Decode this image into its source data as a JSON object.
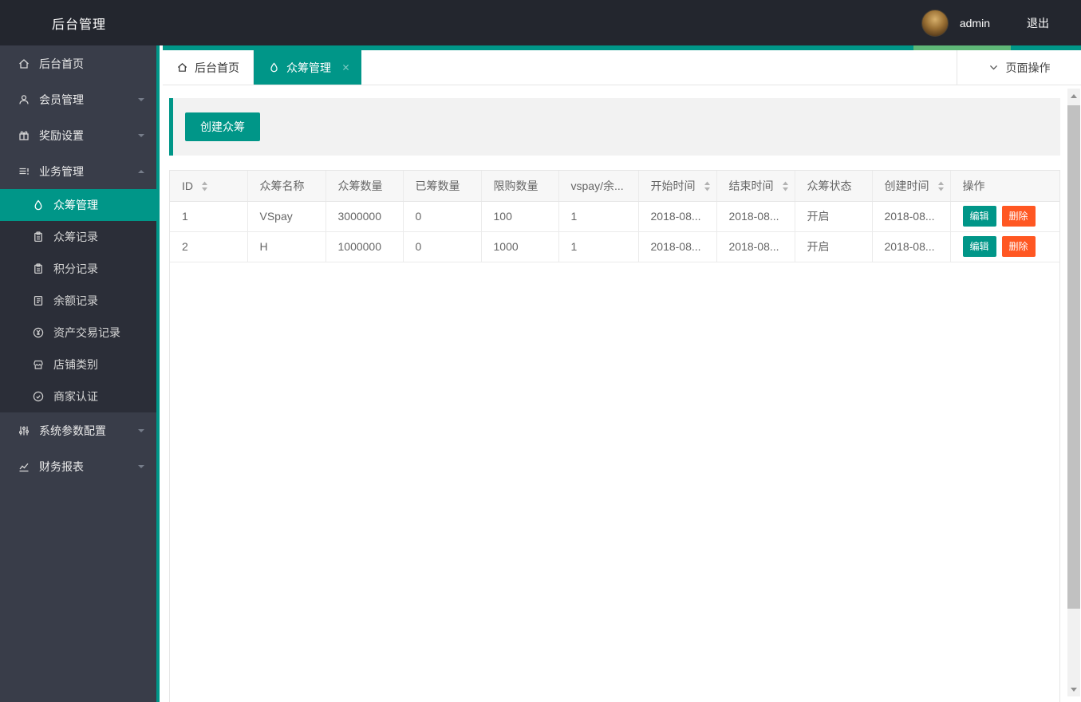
{
  "header": {
    "title": "后台管理",
    "username": "admin",
    "logout_label": "退出"
  },
  "tabs": [
    {
      "label": "后台首页",
      "icon": "home",
      "active": false
    },
    {
      "label": "众筹管理",
      "icon": "water-drop",
      "active": true,
      "closable": true
    }
  ],
  "page_ops": {
    "label": "页面操作"
  },
  "sidebar": {
    "items": [
      {
        "label": "后台首页",
        "icon": "home",
        "expandable": false
      },
      {
        "label": "会员管理",
        "icon": "user",
        "expandable": true,
        "expanded": false
      },
      {
        "label": "奖励设置",
        "icon": "gift",
        "expandable": true,
        "expanded": false
      },
      {
        "label": "业务管理",
        "icon": "list",
        "expandable": true,
        "expanded": true,
        "children": [
          {
            "label": "众筹管理",
            "icon": "water-drop",
            "active": true
          },
          {
            "label": "众筹记录",
            "icon": "clipboard"
          },
          {
            "label": "积分记录",
            "icon": "clipboard"
          },
          {
            "label": "余额记录",
            "icon": "document"
          },
          {
            "label": "资产交易记录",
            "icon": "coin-yen"
          },
          {
            "label": "店铺类别",
            "icon": "shop"
          },
          {
            "label": "商家认证",
            "icon": "badge"
          }
        ]
      },
      {
        "label": "系统参数配置",
        "icon": "sliders",
        "expandable": true,
        "expanded": false
      },
      {
        "label": "财务报表",
        "icon": "chart",
        "expandable": true,
        "expanded": false
      }
    ]
  },
  "toolbar": {
    "create_label": "创建众筹"
  },
  "table": {
    "edit_label": "编辑",
    "delete_label": "删除",
    "columns": [
      {
        "label": "ID",
        "sortable": true
      },
      {
        "label": "众筹名称",
        "sortable": false
      },
      {
        "label": "众筹数量",
        "sortable": false
      },
      {
        "label": "已筹数量",
        "sortable": false
      },
      {
        "label": "限购数量",
        "sortable": false
      },
      {
        "label": "vspay/余...",
        "sortable": false
      },
      {
        "label": "开始时间",
        "sortable": true
      },
      {
        "label": "结束时间",
        "sortable": true
      },
      {
        "label": "众筹状态",
        "sortable": false
      },
      {
        "label": "创建时间",
        "sortable": true
      },
      {
        "label": "操作",
        "sortable": false
      }
    ],
    "rows": [
      {
        "id": "1",
        "name": "VSpay",
        "total": "3000000",
        "raised": "0",
        "limit": "100",
        "rate": "1",
        "start": "2018-08...",
        "end": "2018-08...",
        "status": "开启",
        "created": "2018-08..."
      },
      {
        "id": "2",
        "name": "H",
        "total": "1000000",
        "raised": "0",
        "limit": "1000",
        "rate": "1",
        "start": "2018-08...",
        "end": "2018-08...",
        "status": "开启",
        "created": "2018-08..."
      }
    ]
  },
  "colors": {
    "accent": "#009688",
    "danger": "#FF5722",
    "green": "#5FB878",
    "sidebar_bg": "#393d49",
    "submenu_bg": "#2b2e38",
    "header_bg": "#23262e"
  }
}
